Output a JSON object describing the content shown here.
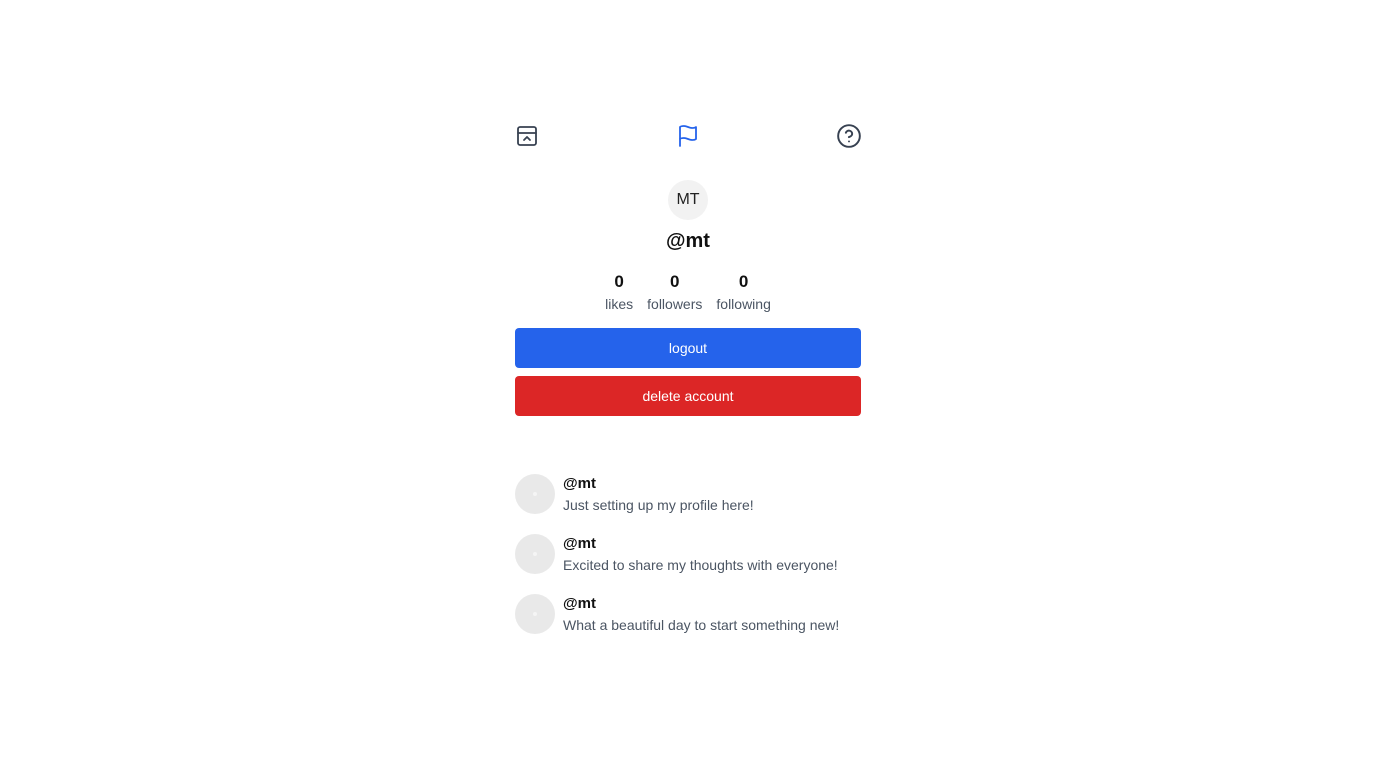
{
  "topbar": {
    "left_icon": "inbox-icon",
    "center_icon": "flag-icon",
    "right_icon": "help-circle-icon"
  },
  "profile": {
    "initials": "MT",
    "username": "@mt"
  },
  "stats": [
    {
      "value": "0",
      "label": "likes"
    },
    {
      "value": "0",
      "label": "followers"
    },
    {
      "value": "0",
      "label": "following"
    }
  ],
  "actions": {
    "logout_label": "logout",
    "delete_label": "delete account"
  },
  "posts": [
    {
      "author": "@mt",
      "text": "Just setting up my profile here!"
    },
    {
      "author": "@mt",
      "text": "Excited to share my thoughts with everyone!"
    },
    {
      "author": "@mt",
      "text": "What a beautiful day to start something new!"
    }
  ],
  "colors": {
    "primary": "#2563eb",
    "danger": "#dc2626",
    "icon_default": "#374151",
    "icon_active": "#2563eb"
  }
}
